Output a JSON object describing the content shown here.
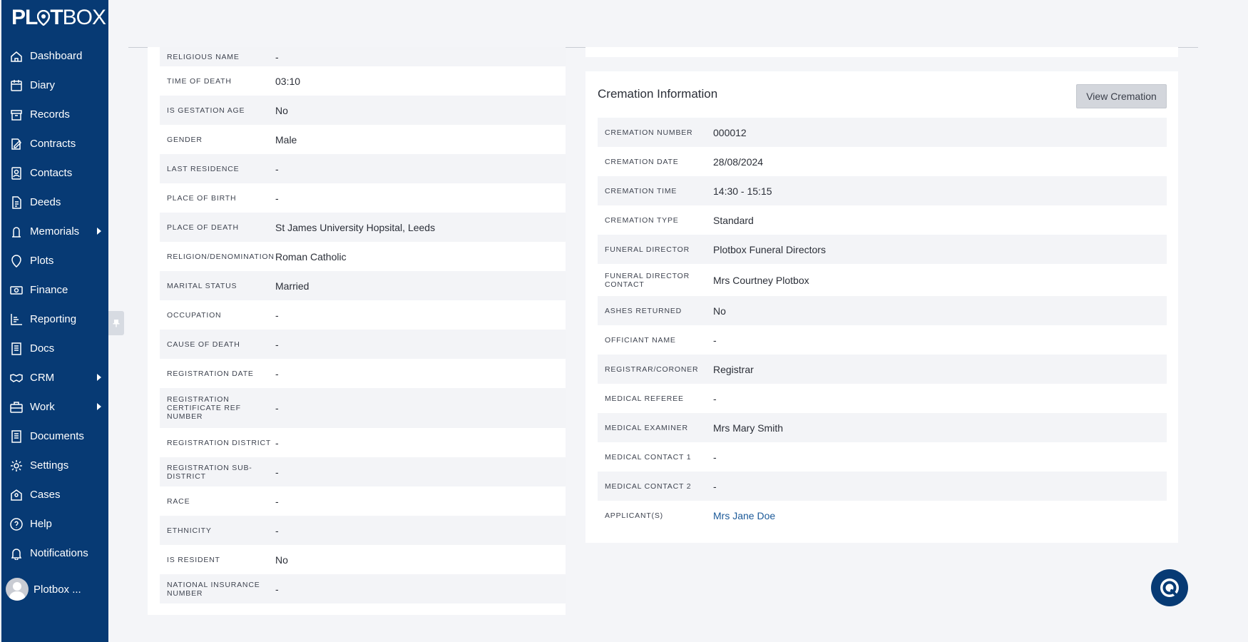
{
  "brand": {
    "logo_text_bold": "PL",
    "logo_text_bold2": "T",
    "logo_text_thin": "BOX"
  },
  "colors": {
    "sidebar": "#073a74",
    "link": "#1c5a99"
  },
  "nav": [
    {
      "label": "Dashboard",
      "icon": "home-icon"
    },
    {
      "label": "Diary",
      "icon": "calendar-icon"
    },
    {
      "label": "Records",
      "icon": "archive-icon"
    },
    {
      "label": "Contracts",
      "icon": "contract-icon"
    },
    {
      "label": "Contacts",
      "icon": "contact-card-icon"
    },
    {
      "label": "Deeds",
      "icon": "document-icon"
    },
    {
      "label": "Memorials",
      "icon": "memorial-icon",
      "submenu": true
    },
    {
      "label": "Plots",
      "icon": "map-pin-icon"
    },
    {
      "label": "Finance",
      "icon": "money-icon"
    },
    {
      "label": "Reporting",
      "icon": "bar-chart-icon"
    },
    {
      "label": "Docs",
      "icon": "docs-icon"
    },
    {
      "label": "CRM",
      "icon": "handshake-icon",
      "submenu": true
    },
    {
      "label": "Work",
      "icon": "briefcase-icon",
      "submenu": true
    },
    {
      "label": "Documents",
      "icon": "documents-icon"
    },
    {
      "label": "Settings",
      "icon": "gear-icon"
    },
    {
      "label": "Cases",
      "icon": "cases-icon"
    },
    {
      "label": "Help",
      "icon": "help-icon"
    },
    {
      "label": "Notifications",
      "icon": "bell-icon"
    }
  ],
  "user": {
    "name": "Plotbox ..."
  },
  "deceased_details": [
    {
      "label": "RELIGIOUS NAME",
      "value": "-"
    },
    {
      "label": "TIME OF DEATH",
      "value": "03:10"
    },
    {
      "label": "IS GESTATION AGE",
      "value": "No"
    },
    {
      "label": "GENDER",
      "value": "Male"
    },
    {
      "label": "LAST RESIDENCE",
      "value": "-"
    },
    {
      "label": "PLACE OF BIRTH",
      "value": "-"
    },
    {
      "label": "PLACE OF DEATH",
      "value": "St James University Hopsital, Leeds"
    },
    {
      "label": "RELIGION/DENOMINATION",
      "value": "Roman Catholic"
    },
    {
      "label": "MARITAL STATUS",
      "value": "Married"
    },
    {
      "label": "OCCUPATION",
      "value": "-"
    },
    {
      "label": "CAUSE OF DEATH",
      "value": "-"
    },
    {
      "label": "REGISTRATION DATE",
      "value": "-"
    },
    {
      "label": "REGISTRATION CERTIFICATE REF NUMBER",
      "value": "-"
    },
    {
      "label": "REGISTRATION DISTRICT",
      "value": "-"
    },
    {
      "label": "REGISTRATION SUB-DISTRICT",
      "value": "-"
    },
    {
      "label": "RACE",
      "value": "-"
    },
    {
      "label": "ETHNICITY",
      "value": "-"
    },
    {
      "label": "IS RESIDENT",
      "value": "No"
    },
    {
      "label": "NATIONAL INSURANCE NUMBER",
      "value": "-"
    }
  ],
  "cremation": {
    "title": "Cremation Information",
    "button": "View Cremation",
    "rows": [
      {
        "label": "CREMATION NUMBER",
        "value": "000012"
      },
      {
        "label": "CREMATION DATE",
        "value": "28/08/2024"
      },
      {
        "label": "CREMATION TIME",
        "value": "14:30 - 15:15"
      },
      {
        "label": "CREMATION TYPE",
        "value": "Standard"
      },
      {
        "label": "FUNERAL DIRECTOR",
        "value": "Plotbox Funeral Directors"
      },
      {
        "label": "FUNERAL DIRECTOR CONTACT",
        "value": "Mrs Courtney Plotbox"
      },
      {
        "label": "ASHES RETURNED",
        "value": "No"
      },
      {
        "label": "OFFICIANT NAME",
        "value": "-"
      },
      {
        "label": "REGISTRAR/CORONER",
        "value": "Registrar"
      },
      {
        "label": "MEDICAL REFEREE",
        "value": "-"
      },
      {
        "label": "MEDICAL EXAMINER",
        "value": "Mrs Mary Smith"
      },
      {
        "label": "MEDICAL CONTACT 1",
        "value": "-"
      },
      {
        "label": "MEDICAL CONTACT 2",
        "value": "-"
      },
      {
        "label": "APPLICANT(S)",
        "value": "Mrs Jane Doe",
        "link": true
      }
    ]
  }
}
